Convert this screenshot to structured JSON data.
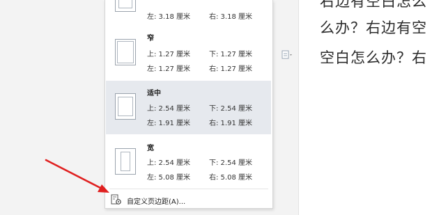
{
  "document": {
    "lines": [
      "右边有空白怎么",
      "么办？右边有空",
      "空白怎么办？右"
    ]
  },
  "margins_menu": {
    "presets": [
      {
        "name": "",
        "top": "",
        "bottom": "",
        "left": "左: 3.18 厘米",
        "right": "右: 3.18 厘米",
        "selected": false
      },
      {
        "name": "窄",
        "top": "上: 1.27 厘米",
        "bottom": "下: 1.27 厘米",
        "left": "左: 1.27 厘米",
        "right": "右: 1.27 厘米",
        "selected": false
      },
      {
        "name": "适中",
        "top": "上: 2.54 厘米",
        "bottom": "下: 2.54 厘米",
        "left": "左: 1.91 厘米",
        "right": "右: 1.91 厘米",
        "selected": true
      },
      {
        "name": "宽",
        "top": "上: 2.54 厘米",
        "bottom": "下: 2.54 厘米",
        "left": "左: 5.08 厘米",
        "right": "右: 5.08 厘米",
        "selected": false
      }
    ],
    "custom_label": "自定义页边距(A)..."
  },
  "colors": {
    "selected_bg": "#e6e9ee",
    "arrow": "#e02020"
  }
}
